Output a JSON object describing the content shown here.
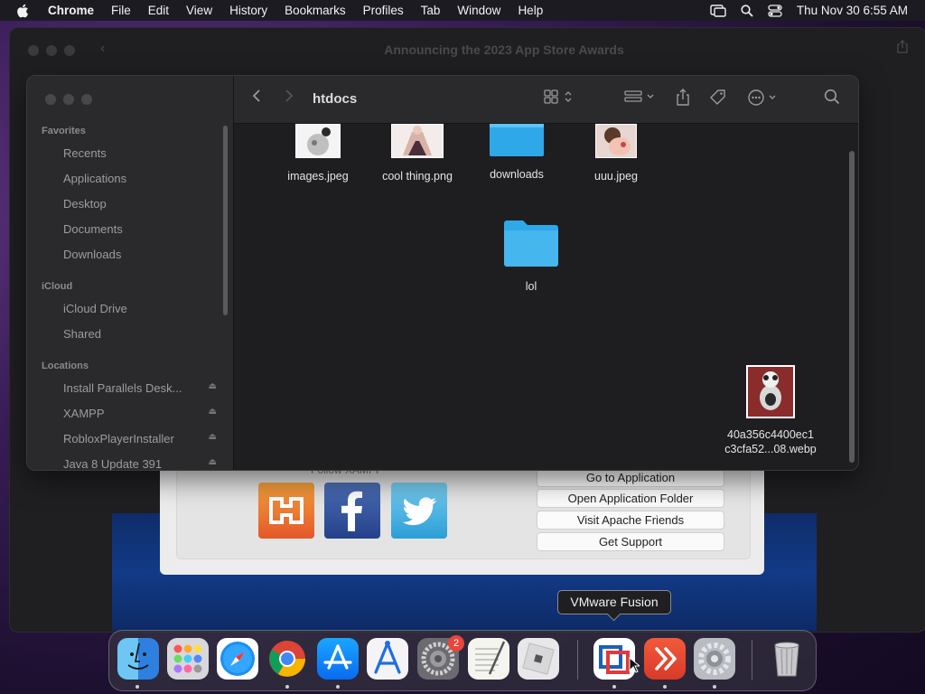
{
  "menubar": {
    "app_name": "Chrome",
    "items": [
      "File",
      "Edit",
      "View",
      "History",
      "Bookmarks",
      "Profiles",
      "Tab",
      "Window",
      "Help"
    ],
    "clock": "Thu Nov 30  6:55 AM"
  },
  "chrome_window": {
    "title": "Announcing the 2023 App Store Awards"
  },
  "finder": {
    "folder_title": "htdocs",
    "sidebar": {
      "favorites_header": "Favorites",
      "favorites": [
        "Recents",
        "Applications",
        "Desktop",
        "Documents",
        "Downloads"
      ],
      "icloud_header": "iCloud",
      "icloud": [
        "iCloud Drive",
        "Shared"
      ],
      "locations_header": "Locations",
      "locations": [
        "Install Parallels Desk...",
        "XAMPP",
        "RobloxPlayerInstaller",
        "Java 8 Update 391"
      ]
    },
    "files": [
      {
        "name": "images.jpeg"
      },
      {
        "name": "cool thing.png"
      },
      {
        "name": "downloads"
      },
      {
        "name": "uuu.jpeg"
      },
      {
        "name": "lol"
      },
      {
        "name_line1": "40a356c4400ec1",
        "name_line2": "c3cfa52...08.webp"
      }
    ]
  },
  "xampp": {
    "follow_label": "Follow  XAMPP",
    "buttons": [
      "Go to Application",
      "Open Application Folder",
      "Visit Apache Friends",
      "Get Support"
    ]
  },
  "tooltip": "VMware Fusion",
  "dock": {
    "badge_count": "2"
  },
  "colors": {
    "folder_blue": "#2ea8e8",
    "badge_red": "#e8453c"
  }
}
